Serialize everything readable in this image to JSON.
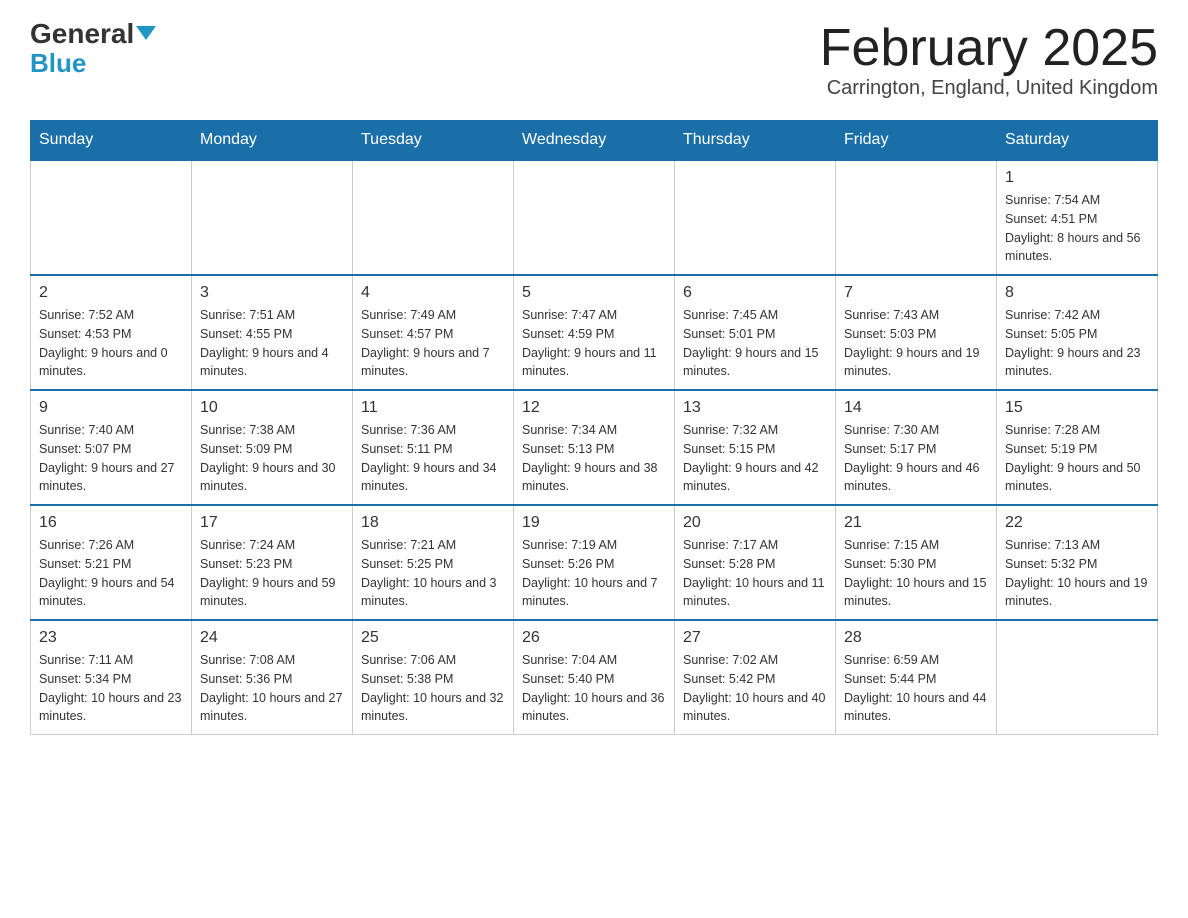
{
  "logo": {
    "text1": "General",
    "text2": "Blue"
  },
  "header": {
    "title": "February 2025",
    "location": "Carrington, England, United Kingdom"
  },
  "weekdays": [
    "Sunday",
    "Monday",
    "Tuesday",
    "Wednesday",
    "Thursday",
    "Friday",
    "Saturday"
  ],
  "weeks": [
    [
      {
        "day": "",
        "info": ""
      },
      {
        "day": "",
        "info": ""
      },
      {
        "day": "",
        "info": ""
      },
      {
        "day": "",
        "info": ""
      },
      {
        "day": "",
        "info": ""
      },
      {
        "day": "",
        "info": ""
      },
      {
        "day": "1",
        "info": "Sunrise: 7:54 AM\nSunset: 4:51 PM\nDaylight: 8 hours and 56 minutes."
      }
    ],
    [
      {
        "day": "2",
        "info": "Sunrise: 7:52 AM\nSunset: 4:53 PM\nDaylight: 9 hours and 0 minutes."
      },
      {
        "day": "3",
        "info": "Sunrise: 7:51 AM\nSunset: 4:55 PM\nDaylight: 9 hours and 4 minutes."
      },
      {
        "day": "4",
        "info": "Sunrise: 7:49 AM\nSunset: 4:57 PM\nDaylight: 9 hours and 7 minutes."
      },
      {
        "day": "5",
        "info": "Sunrise: 7:47 AM\nSunset: 4:59 PM\nDaylight: 9 hours and 11 minutes."
      },
      {
        "day": "6",
        "info": "Sunrise: 7:45 AM\nSunset: 5:01 PM\nDaylight: 9 hours and 15 minutes."
      },
      {
        "day": "7",
        "info": "Sunrise: 7:43 AM\nSunset: 5:03 PM\nDaylight: 9 hours and 19 minutes."
      },
      {
        "day": "8",
        "info": "Sunrise: 7:42 AM\nSunset: 5:05 PM\nDaylight: 9 hours and 23 minutes."
      }
    ],
    [
      {
        "day": "9",
        "info": "Sunrise: 7:40 AM\nSunset: 5:07 PM\nDaylight: 9 hours and 27 minutes."
      },
      {
        "day": "10",
        "info": "Sunrise: 7:38 AM\nSunset: 5:09 PM\nDaylight: 9 hours and 30 minutes."
      },
      {
        "day": "11",
        "info": "Sunrise: 7:36 AM\nSunset: 5:11 PM\nDaylight: 9 hours and 34 minutes."
      },
      {
        "day": "12",
        "info": "Sunrise: 7:34 AM\nSunset: 5:13 PM\nDaylight: 9 hours and 38 minutes."
      },
      {
        "day": "13",
        "info": "Sunrise: 7:32 AM\nSunset: 5:15 PM\nDaylight: 9 hours and 42 minutes."
      },
      {
        "day": "14",
        "info": "Sunrise: 7:30 AM\nSunset: 5:17 PM\nDaylight: 9 hours and 46 minutes."
      },
      {
        "day": "15",
        "info": "Sunrise: 7:28 AM\nSunset: 5:19 PM\nDaylight: 9 hours and 50 minutes."
      }
    ],
    [
      {
        "day": "16",
        "info": "Sunrise: 7:26 AM\nSunset: 5:21 PM\nDaylight: 9 hours and 54 minutes."
      },
      {
        "day": "17",
        "info": "Sunrise: 7:24 AM\nSunset: 5:23 PM\nDaylight: 9 hours and 59 minutes."
      },
      {
        "day": "18",
        "info": "Sunrise: 7:21 AM\nSunset: 5:25 PM\nDaylight: 10 hours and 3 minutes."
      },
      {
        "day": "19",
        "info": "Sunrise: 7:19 AM\nSunset: 5:26 PM\nDaylight: 10 hours and 7 minutes."
      },
      {
        "day": "20",
        "info": "Sunrise: 7:17 AM\nSunset: 5:28 PM\nDaylight: 10 hours and 11 minutes."
      },
      {
        "day": "21",
        "info": "Sunrise: 7:15 AM\nSunset: 5:30 PM\nDaylight: 10 hours and 15 minutes."
      },
      {
        "day": "22",
        "info": "Sunrise: 7:13 AM\nSunset: 5:32 PM\nDaylight: 10 hours and 19 minutes."
      }
    ],
    [
      {
        "day": "23",
        "info": "Sunrise: 7:11 AM\nSunset: 5:34 PM\nDaylight: 10 hours and 23 minutes."
      },
      {
        "day": "24",
        "info": "Sunrise: 7:08 AM\nSunset: 5:36 PM\nDaylight: 10 hours and 27 minutes."
      },
      {
        "day": "25",
        "info": "Sunrise: 7:06 AM\nSunset: 5:38 PM\nDaylight: 10 hours and 32 minutes."
      },
      {
        "day": "26",
        "info": "Sunrise: 7:04 AM\nSunset: 5:40 PM\nDaylight: 10 hours and 36 minutes."
      },
      {
        "day": "27",
        "info": "Sunrise: 7:02 AM\nSunset: 5:42 PM\nDaylight: 10 hours and 40 minutes."
      },
      {
        "day": "28",
        "info": "Sunrise: 6:59 AM\nSunset: 5:44 PM\nDaylight: 10 hours and 44 minutes."
      },
      {
        "day": "",
        "info": ""
      }
    ]
  ]
}
